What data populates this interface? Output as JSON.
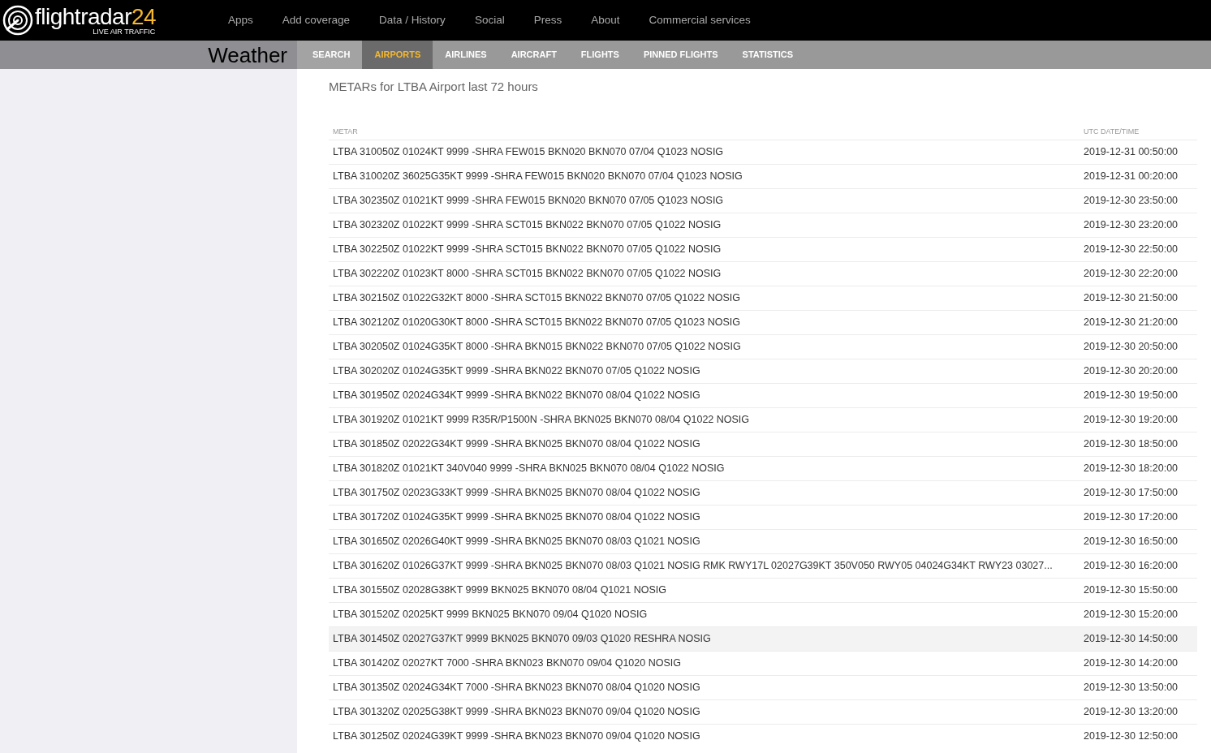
{
  "logo": {
    "name": "flightradar",
    "number": "24",
    "tagline": "LIVE AIR TRAFFIC"
  },
  "top_nav": [
    "Apps",
    "Add coverage",
    "Data / History",
    "Social",
    "Press",
    "About",
    "Commercial services"
  ],
  "page_title": "Weather",
  "sub_nav": [
    {
      "label": "SEARCH",
      "selected": false,
      "kind": "search"
    },
    {
      "label": "AIRPORTS",
      "selected": true,
      "kind": "tab"
    },
    {
      "label": "AIRLINES",
      "selected": false,
      "kind": "tab"
    },
    {
      "label": "AIRCRAFT",
      "selected": false,
      "kind": "tab"
    },
    {
      "label": "FLIGHTS",
      "selected": false,
      "kind": "tab"
    },
    {
      "label": "PINNED FLIGHTS",
      "selected": false,
      "kind": "tab"
    },
    {
      "label": "STATISTICS",
      "selected": false,
      "kind": "tab"
    }
  ],
  "heading": "METARs for LTBA Airport last 72 hours",
  "table": {
    "columns": [
      "METAR",
      "UTC DATE/TIME"
    ],
    "rows": [
      {
        "metar": "LTBA 310050Z 01024KT 9999 -SHRA FEW015 BKN020 BKN070 07/04 Q1023 NOSIG",
        "time": "2019-12-31 00:50:00",
        "hovered": false
      },
      {
        "metar": "LTBA 310020Z 36025G35KT 9999 -SHRA FEW015 BKN020 BKN070 07/04 Q1023 NOSIG",
        "time": "2019-12-31 00:20:00",
        "hovered": false
      },
      {
        "metar": "LTBA 302350Z 01021KT 9999 -SHRA FEW015 BKN020 BKN070 07/05 Q1023 NOSIG",
        "time": "2019-12-30 23:50:00",
        "hovered": false
      },
      {
        "metar": "LTBA 302320Z 01022KT 9999 -SHRA SCT015 BKN022 BKN070 07/05 Q1022 NOSIG",
        "time": "2019-12-30 23:20:00",
        "hovered": false
      },
      {
        "metar": "LTBA 302250Z 01022KT 9999 -SHRA SCT015 BKN022 BKN070 07/05 Q1022 NOSIG",
        "time": "2019-12-30 22:50:00",
        "hovered": false
      },
      {
        "metar": "LTBA 302220Z 01023KT 8000 -SHRA SCT015 BKN022 BKN070 07/05 Q1022 NOSIG",
        "time": "2019-12-30 22:20:00",
        "hovered": false
      },
      {
        "metar": "LTBA 302150Z 01022G32KT 8000 -SHRA SCT015 BKN022 BKN070 07/05 Q1022 NOSIG",
        "time": "2019-12-30 21:50:00",
        "hovered": false
      },
      {
        "metar": "LTBA 302120Z 01020G30KT 8000 -SHRA SCT015 BKN022 BKN070 07/05 Q1023 NOSIG",
        "time": "2019-12-30 21:20:00",
        "hovered": false
      },
      {
        "metar": "LTBA 302050Z 01024G35KT 8000 -SHRA BKN015 BKN022 BKN070 07/05 Q1022 NOSIG",
        "time": "2019-12-30 20:50:00",
        "hovered": false
      },
      {
        "metar": "LTBA 302020Z 01024G35KT 9999 -SHRA BKN022 BKN070 07/05 Q1022 NOSIG",
        "time": "2019-12-30 20:20:00",
        "hovered": false
      },
      {
        "metar": "LTBA 301950Z 02024G34KT 9999 -SHRA BKN022 BKN070 08/04 Q1022 NOSIG",
        "time": "2019-12-30 19:50:00",
        "hovered": false
      },
      {
        "metar": "LTBA 301920Z 01021KT 9999 R35R/P1500N -SHRA BKN025 BKN070 08/04 Q1022 NOSIG",
        "time": "2019-12-30 19:20:00",
        "hovered": false
      },
      {
        "metar": "LTBA 301850Z 02022G34KT 9999 -SHRA BKN025 BKN070 08/04 Q1022 NOSIG",
        "time": "2019-12-30 18:50:00",
        "hovered": false
      },
      {
        "metar": "LTBA 301820Z 01021KT 340V040 9999 -SHRA BKN025 BKN070 08/04 Q1022 NOSIG",
        "time": "2019-12-30 18:20:00",
        "hovered": false
      },
      {
        "metar": "LTBA 301750Z 02023G33KT 9999 -SHRA BKN025 BKN070 08/04 Q1022 NOSIG",
        "time": "2019-12-30 17:50:00",
        "hovered": false
      },
      {
        "metar": "LTBA 301720Z 01024G35KT 9999 -SHRA BKN025 BKN070 08/04 Q1022 NOSIG",
        "time": "2019-12-30 17:20:00",
        "hovered": false
      },
      {
        "metar": "LTBA 301650Z 02026G40KT 9999 -SHRA BKN025 BKN070 08/03 Q1021 NOSIG",
        "time": "2019-12-30 16:50:00",
        "hovered": false
      },
      {
        "metar": "LTBA 301620Z 01026G37KT 9999 -SHRA BKN025 BKN070 08/03 Q1021 NOSIG RMK RWY17L 02027G39KT 350V050 RWY05 04024G34KT RWY23 03027...",
        "time": "2019-12-30 16:20:00",
        "hovered": false
      },
      {
        "metar": "LTBA 301550Z 02028G38KT 9999 BKN025 BKN070 08/04 Q1021 NOSIG",
        "time": "2019-12-30 15:50:00",
        "hovered": false
      },
      {
        "metar": "LTBA 301520Z 02025KT 9999 BKN025 BKN070 09/04 Q1020 NOSIG",
        "time": "2019-12-30 15:20:00",
        "hovered": false
      },
      {
        "metar": "LTBA 301450Z 02027G37KT 9999 BKN025 BKN070 09/03 Q1020 RESHRA NOSIG",
        "time": "2019-12-30 14:50:00",
        "hovered": true
      },
      {
        "metar": "LTBA 301420Z 02027KT 7000 -SHRA BKN023 BKN070 09/04 Q1020 NOSIG",
        "time": "2019-12-30 14:20:00",
        "hovered": false
      },
      {
        "metar": "LTBA 301350Z 02024G34KT 7000 -SHRA BKN023 BKN070 08/04 Q1020 NOSIG",
        "time": "2019-12-30 13:50:00",
        "hovered": false
      },
      {
        "metar": "LTBA 301320Z 02025G38KT 9999 -SHRA BKN023 BKN070 09/04 Q1020 NOSIG",
        "time": "2019-12-30 13:20:00",
        "hovered": false
      },
      {
        "metar": "LTBA 301250Z 02024G39KT 9999 -SHRA BKN023 BKN070 09/04 Q1020 NOSIG",
        "time": "2019-12-30 12:50:00",
        "hovered": false
      }
    ]
  }
}
